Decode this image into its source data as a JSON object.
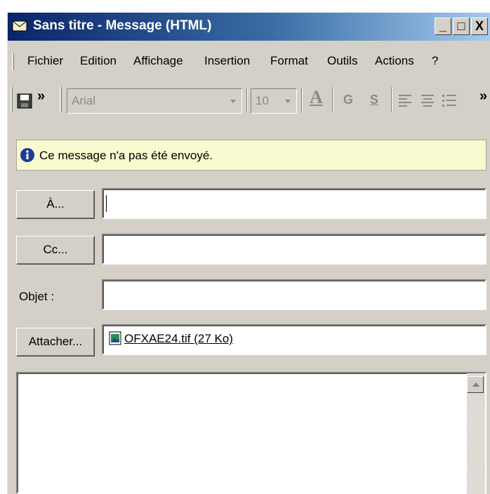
{
  "window": {
    "title": "Sans titre - Message (HTML)",
    "controls": {
      "minimize": "_",
      "maximize": "□",
      "close": "X"
    }
  },
  "menu": {
    "items": [
      "Fichier",
      "Edition",
      "Affichage",
      "Insertion",
      "Format",
      "Outils",
      "Actions",
      "?"
    ]
  },
  "toolbar": {
    "font": "Arial",
    "size": "10",
    "bold": "G",
    "underline": "S",
    "overflow": "»"
  },
  "infobar": {
    "message": "Ce message n'a pas été envoyé."
  },
  "fields": {
    "to_button": "À...",
    "cc_button": "Cc...",
    "subject_label": "Objet :",
    "attach_button": "Attacher...",
    "to_value": "",
    "cc_value": "",
    "subject_value": "",
    "attachment": "OFXAE24.tif (27 Ko)"
  },
  "icons": {
    "app": "envelope-icon",
    "save": "save-icon",
    "info": "info-icon",
    "attachment": "image-file-icon"
  },
  "colors": {
    "titlebar_start": "#0a246a",
    "titlebar_end": "#a6caf0",
    "infobar_bg": "#fafad0",
    "chrome": "#d4d0c8"
  }
}
